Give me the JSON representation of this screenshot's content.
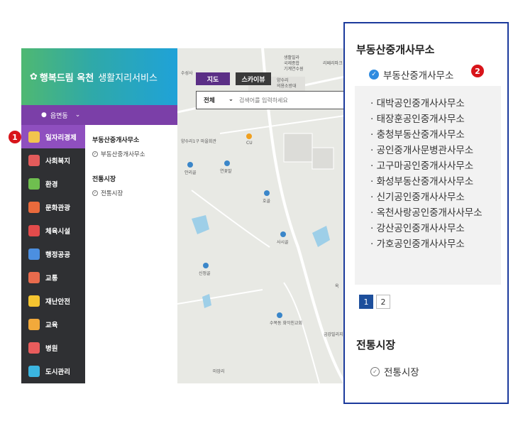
{
  "brand": {
    "logo": "행복드림 옥천",
    "service": "생활지리서비스"
  },
  "region": {
    "label": "읍면동"
  },
  "nav": [
    {
      "label": "일자리경제",
      "icon": "chart-icon",
      "color": "#f2c44e",
      "active": true
    },
    {
      "label": "사회복지",
      "icon": "heart-hands-icon",
      "color": "#e35b5b"
    },
    {
      "label": "환경",
      "icon": "tree-icon",
      "color": "#6fbf4f"
    },
    {
      "label": "문화관광",
      "icon": "pinwheel-icon",
      "color": "#e96a3c"
    },
    {
      "label": "체육시설",
      "icon": "ball-icon",
      "color": "#e24b4b"
    },
    {
      "label": "행정공공",
      "icon": "monitor-icon",
      "color": "#4c8fe0"
    },
    {
      "label": "교통",
      "icon": "bus-icon",
      "color": "#e86b4d"
    },
    {
      "label": "재난안전",
      "icon": "warning-icon",
      "color": "#f4c430"
    },
    {
      "label": "교육",
      "icon": "pencil-icon",
      "color": "#f2a93b"
    },
    {
      "label": "병원",
      "icon": "medical-icon",
      "color": "#e85c5c"
    },
    {
      "label": "도시관리",
      "icon": "building-icon",
      "color": "#3bb5e0"
    }
  ],
  "subpanel": {
    "section1_title": "부동산중개사무소",
    "section1_item": "부동산중개사무소",
    "section2_title": "전통시장",
    "section2_item": "전통시장"
  },
  "map": {
    "btn_map": "지도",
    "btn_sky": "스카이뷰",
    "search_scope": "전체",
    "search_placeholder": "검색어를 입력하세요",
    "labels": {
      "l1": "생활빌라",
      "l2": "국제종합",
      "l3": "기계연수원",
      "l4": "수성사",
      "l5": "양수리",
      "l6": "의용소방대",
      "l7": "리페리파크",
      "l8": "양수리1구 마을회관",
      "l9": "CU",
      "l10": "안리골",
      "l11": "연꽃말",
      "l12": "호골",
      "l13": "사시골",
      "l14": "신정골",
      "l15": "옥",
      "l16": "수목동 화악친교회",
      "l17": "금강빌리지",
      "l18": "마암리"
    }
  },
  "zoom": {
    "title": "부동산중개사무소",
    "category": "부동산중개사무소",
    "items": [
      "대박공인중개사사무소",
      "태장훈공인중개사무소",
      "충청부동산중개사무소",
      "공인중개사문병관사무소",
      "고구마공인중개사사무소",
      "화성부동산중개사사무소",
      "신기공인중개사사무소",
      "옥천사랑공인중개사사무소",
      "강산공인중개사사무소",
      "가호공인중개사사무소"
    ],
    "pages": [
      "1",
      "2"
    ],
    "title2": "전통시장",
    "category2": "전통시장"
  },
  "badges": {
    "b1": "1",
    "b2": "2"
  }
}
